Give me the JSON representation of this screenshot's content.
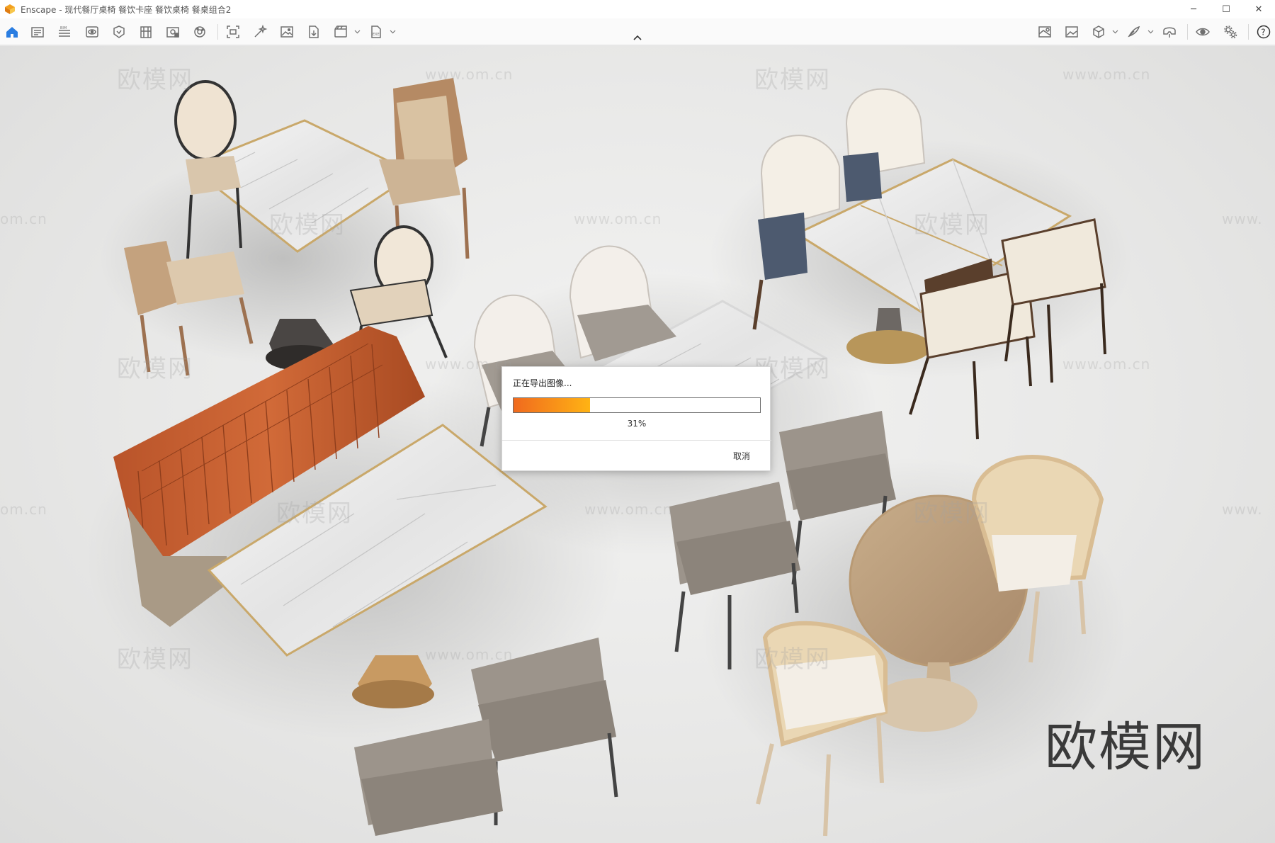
{
  "window": {
    "title": "Enscape - 现代餐厅桌椅 餐饮卡座 餐饮桌椅 餐桌组合2",
    "controls": {
      "minimize": "─",
      "maximize": "☐",
      "close": "✕"
    }
  },
  "toolbar": {
    "icons": [
      "home-icon",
      "views-icon",
      "bim-icon",
      "visual-settings-icon",
      "assets-icon",
      "building-icon",
      "panorama-icon",
      "material-icon",
      "screenshot-icon",
      "capture-icon",
      "image-icon",
      "export-icon",
      "video-icon",
      "batch-render-icon",
      "map-icon",
      "gallery-icon",
      "cube-icon",
      "sketch-icon",
      "vr-headset-icon",
      "eye-icon",
      "settings-icon",
      "help-icon"
    ],
    "colors": {
      "home": "#2a7de1",
      "icon": "#6f6f6f"
    }
  },
  "viewport": {
    "watermarks": [
      "欧模网",
      "www.om.cn",
      "om.cn",
      "www."
    ],
    "brand_mark": "欧模网"
  },
  "dialog": {
    "title": "正在导出图像...",
    "progress": 0.31,
    "progress_text": "31%",
    "cancel_label": "取消",
    "colors": {
      "fill_start": "#f06a1e",
      "fill_end": "#ffb314"
    }
  }
}
